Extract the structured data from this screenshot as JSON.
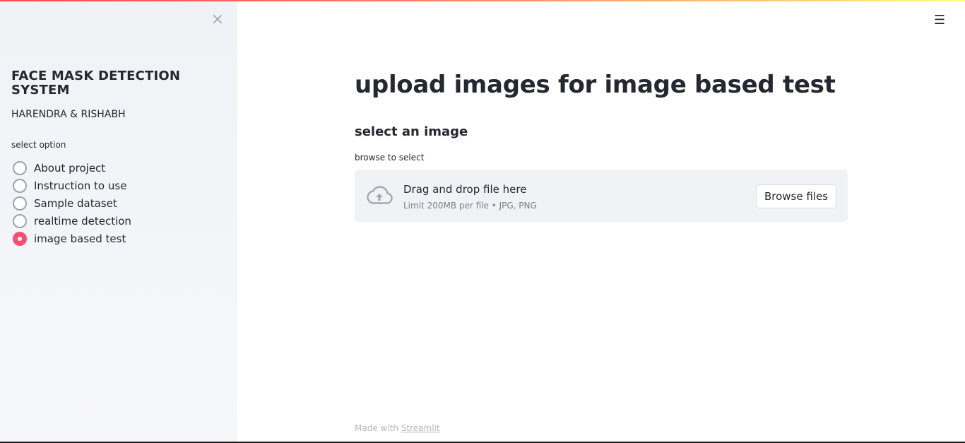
{
  "sidebar": {
    "close_glyph": "×",
    "app_title": "FACE MASK DETECTION SYSTEM",
    "authors": "HARENDRA & RISHABH",
    "radio_label": "select option",
    "options": [
      {
        "label": "About project",
        "selected": false
      },
      {
        "label": "Instruction to use",
        "selected": false
      },
      {
        "label": "Sample dataset",
        "selected": false
      },
      {
        "label": "realtime detection",
        "selected": false
      },
      {
        "label": "image based test",
        "selected": true
      }
    ]
  },
  "header": {
    "menu_glyph": "☰"
  },
  "main": {
    "title": "upload images for image based test",
    "subheader": "select an image",
    "uploader": {
      "label": "browse to select",
      "drop_title": "Drag and drop file here",
      "limit_text": "Limit 200MB per file • JPG, PNG",
      "browse_label": "Browse files"
    }
  },
  "footer": {
    "prefix": "Made with ",
    "link": "Streamlit"
  },
  "colors": {
    "accent": "#ff4b6e",
    "sidebar_bg": "#f0f2f6",
    "dropzone_bg": "#f0f2f6",
    "text": "#262730"
  }
}
